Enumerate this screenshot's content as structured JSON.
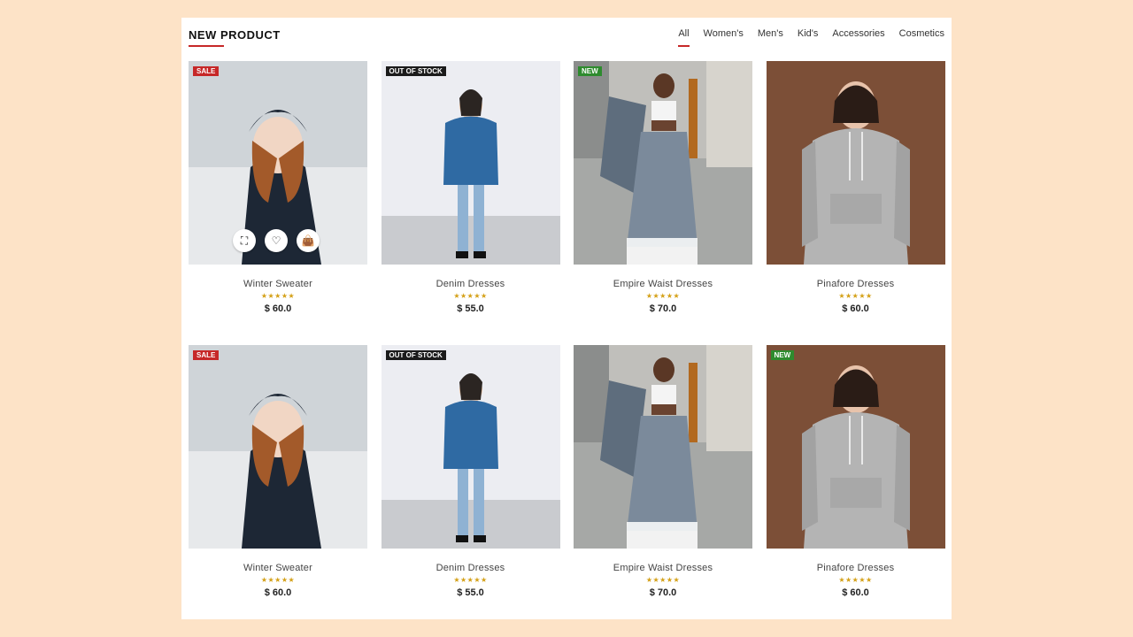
{
  "section": {
    "title": "NEW PRODUCT"
  },
  "tabs": [
    {
      "label": "All",
      "active": true
    },
    {
      "label": "Women's",
      "active": false
    },
    {
      "label": "Men's",
      "active": false
    },
    {
      "label": "Kid's",
      "active": false
    },
    {
      "label": "Accessories",
      "active": false
    },
    {
      "label": "Cosmetics",
      "active": false
    }
  ],
  "products": [
    {
      "name": "Winter Sweater",
      "price": "$ 60.0",
      "badge": "SALE",
      "badge_kind": "sale",
      "rating": "★★★★★",
      "show_actions": true,
      "image": "winter"
    },
    {
      "name": "Denim Dresses",
      "price": "$ 55.0",
      "badge": "OUT OF STOCK",
      "badge_kind": "oos",
      "rating": "★★★★★",
      "show_actions": false,
      "image": "denim"
    },
    {
      "name": "Empire Waist Dresses",
      "price": "$ 70.0",
      "badge": "NEW",
      "badge_kind": "new",
      "rating": "★★★★★",
      "show_actions": false,
      "image": "empire"
    },
    {
      "name": "Pinafore Dresses",
      "price": "$ 60.0",
      "badge": "",
      "badge_kind": "",
      "rating": "★★★★★",
      "show_actions": false,
      "image": "hoodie"
    },
    {
      "name": "Winter Sweater",
      "price": "$ 60.0",
      "badge": "SALE",
      "badge_kind": "sale",
      "rating": "★★★★★",
      "show_actions": false,
      "image": "winter"
    },
    {
      "name": "Denim Dresses",
      "price": "$ 55.0",
      "badge": "OUT OF STOCK",
      "badge_kind": "oos",
      "rating": "★★★★★",
      "show_actions": false,
      "image": "denim"
    },
    {
      "name": "Empire Waist Dresses",
      "price": "$ 70.0",
      "badge": "",
      "badge_kind": "",
      "rating": "★★★★★",
      "show_actions": false,
      "image": "empire"
    },
    {
      "name": "Pinafore Dresses",
      "price": "$ 60.0",
      "badge": "NEW",
      "badge_kind": "new",
      "rating": "★★★★★",
      "show_actions": false,
      "image": "hoodie"
    }
  ],
  "actions": [
    {
      "icon": "expand-icon",
      "glyph": "⛶"
    },
    {
      "icon": "heart-icon",
      "glyph": "♡"
    },
    {
      "icon": "bag-icon",
      "glyph": "👜"
    }
  ],
  "colors": {
    "accent": "#c62828",
    "sale": "#c62828",
    "new": "#2e8b2e",
    "oos": "#1b1b1b",
    "stars": "#d4a017",
    "background": "#fde3c7"
  }
}
